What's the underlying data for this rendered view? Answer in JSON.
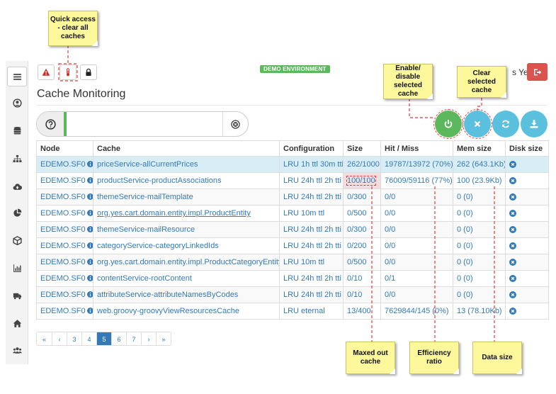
{
  "header": {
    "environment_badge": "DEMO ENVIRONMENT",
    "user_suffix": "s Yes",
    "page_title": "Cache Monitoring"
  },
  "filter": {
    "value": "",
    "placeholder": ""
  },
  "table": {
    "headers": [
      "Node",
      "Cache",
      "Configuration",
      "Size",
      "Hit / Miss",
      "Mem size",
      "Disk size"
    ],
    "rows": [
      {
        "node": "EDEMO.SF0",
        "cache": "priceService-allCurrentPrices",
        "config": "LRU 1h ttl 30m tti",
        "size": "262/1000",
        "hitmiss": "19787/13972 (70%)",
        "mem": "262 (643.1Kb)",
        "underline": false
      },
      {
        "node": "EDEMO.SF0",
        "cache": "productService-productAssociations",
        "config": "LRU 24h ttl 2h tti",
        "size": "100/100",
        "hitmiss": "76009/59116 (77%)",
        "mem": "100 (23.9Kb)",
        "underline": false
      },
      {
        "node": "EDEMO.SF0",
        "cache": "themeService-mailTemplate",
        "config": "LRU 24h ttl 2h tti",
        "size": "0/300",
        "hitmiss": "0/0",
        "mem": "0 (0)",
        "underline": false
      },
      {
        "node": "EDEMO.SF0",
        "cache": "org.yes.cart.domain.entity.impl.ProductEntity",
        "config": "LRU 10m ttl",
        "size": "0/500",
        "hitmiss": "0/0",
        "mem": "0 (0)",
        "underline": true
      },
      {
        "node": "EDEMO.SF0",
        "cache": "themeService-mailResource",
        "config": "LRU 24h ttl 2h tti",
        "size": "0/300",
        "hitmiss": "0/0",
        "mem": "0 (0)",
        "underline": false
      },
      {
        "node": "EDEMO.SF0",
        "cache": "categoryService-categoryLinkedIds",
        "config": "LRU 24h ttl 2h tti",
        "size": "0/200",
        "hitmiss": "0/0",
        "mem": "0 (0)",
        "underline": false
      },
      {
        "node": "EDEMO.SF0",
        "cache": "org.yes.cart.domain.entity.impl.ProductCategoryEntity",
        "config": "LRU 10m ttl",
        "size": "0/500",
        "hitmiss": "0/0",
        "mem": "0 (0)",
        "underline": false
      },
      {
        "node": "EDEMO.SF0",
        "cache": "contentService-rootContent",
        "config": "LRU 24h ttl 2h tti",
        "size": "0/10",
        "hitmiss": "0/1",
        "mem": "0 (0)",
        "underline": false
      },
      {
        "node": "EDEMO.SF0",
        "cache": "attributeService-attributeNamesByCodes",
        "config": "LRU 24h ttl 2h tti",
        "size": "0/10",
        "hitmiss": "0/0",
        "mem": "0 (0)",
        "underline": false
      },
      {
        "node": "EDEMO.SF0",
        "cache": "web.groovy-groovyViewResourcesCache",
        "config": "LRU eternal",
        "size": "13/400",
        "hitmiss": "7629844/145 (0%)",
        "mem": "13 (78.10Kb)",
        "underline": false
      }
    ]
  },
  "pagination": [
    "«",
    "‹",
    "3",
    "4",
    "5",
    "6",
    "7",
    "›",
    "»"
  ],
  "pagination_active": "5",
  "callouts": {
    "quick_access": "Quick access - clear all caches",
    "enable_disable": "Enable/ disable selected cache",
    "clear_selected": "Clear selected cache",
    "maxed_out": "Maxed out cache",
    "efficiency": "Efficiency ratio",
    "data_size": "Data size"
  },
  "colors": {
    "link": "#337ab7",
    "success": "#5cb85c",
    "info": "#5bc0de",
    "danger": "#d9534f",
    "note": "#fdf89c",
    "annotation": "#e03b3b"
  }
}
